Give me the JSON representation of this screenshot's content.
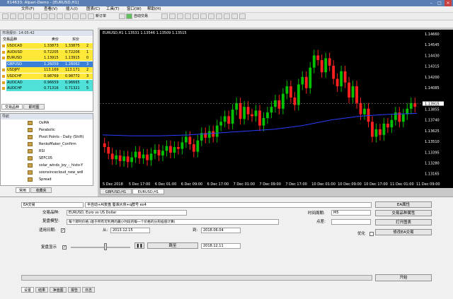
{
  "window": {
    "title": "814633: Alpari-Demo - [EURUSD,H1]"
  },
  "menu": [
    "文件(F)",
    "查看(V)",
    "插入(I)",
    "图表(C)",
    "工具(T)",
    "窗口(W)",
    "帮助(H)"
  ],
  "toolbar": {
    "new_order": "新订单",
    "autotrade": "自动交易"
  },
  "market_watch": {
    "header": "市场报价: 14:05:42",
    "columns": [
      "交易品种",
      "卖价",
      "买价",
      ""
    ],
    "rows": [
      {
        "symbol": "USDCAD",
        "bid": "1.33873",
        "ask": "1.33875",
        "spread": "2",
        "color": "#ffe838"
      },
      {
        "symbol": "AUDUSD",
        "bid": "0.72205",
        "ask": "0.72206",
        "spread": "1",
        "color": "#ffe838"
      },
      {
        "symbol": "EURUSD",
        "bid": "1.13915",
        "ask": "1.13915",
        "spread": "0",
        "color": "#ffe838"
      },
      {
        "symbol": "GBPUSD",
        "bid": "1.26059",
        "ask": "1.26062",
        "spread": "3",
        "color": "#3a7fd8"
      },
      {
        "symbol": "USDJPY",
        "bid": "113.169",
        "ask": "113.171",
        "spread": "2",
        "color": "#ffe838"
      },
      {
        "symbol": "USDCHF",
        "bid": "0.98769",
        "ask": "0.98772",
        "spread": "3",
        "color": "#ffe838"
      },
      {
        "symbol": "AUDCAD",
        "bid": "0.96659",
        "ask": "0.96665",
        "spread": "6",
        "color": "#4fe0d8"
      },
      {
        "symbol": "AUDCHF",
        "bid": "0.71316",
        "ask": "0.71321",
        "spread": "5",
        "color": "#4fe0d8"
      }
    ],
    "tabs": [
      "交易品种",
      "即时图"
    ]
  },
  "navigator": {
    "header": "导航",
    "items": [
      "OsMA",
      "Parabolic",
      "Pivot Points - Daily (Shift)",
      "RenkoMaker_Confirm",
      "RSI",
      "SEFC05",
      "solar_winds_joy_-_histo-Y",
      "soonsincecloud_new_wdl",
      "Spread"
    ],
    "tabs": [
      "常用",
      "收藏夹"
    ]
  },
  "chart": {
    "header": "EURUSD,H1  1.13531 1.13546 1.13509 1.13515",
    "current_price": "1.13915",
    "tabs": [
      "GBPUSD,H1",
      "EURUSD,H1"
    ],
    "active_tab": "EURUSD,H1"
  },
  "chart_data": {
    "type": "candlestick",
    "symbol": "EURUSD",
    "timeframe": "H1",
    "ylim": [
      1.1311,
      1.1466
    ],
    "y_ticks": [
      "1.14660",
      "1.14545",
      "1.14430",
      "1.14315",
      "1.14200",
      "1.14085",
      "1.13915",
      "1.13855",
      "1.13740",
      "1.13625",
      "1.13510",
      "1.13395",
      "1.13280",
      "1.13165"
    ],
    "x_ticks": [
      "5 Dec 2018",
      "5 Dec 17:00",
      "6 Dec 01:00",
      "6 Dec 09:00",
      "6 Dec 17:00",
      "7 Dec 01:00",
      "7 Dec 09:00",
      "7 Dec 17:00",
      "10 Dec 01:00",
      "10 Dec 09:00",
      "10 Dec 17:00",
      "11 Dec 01:00",
      "11 Dec 09:00"
    ],
    "closes": [
      1.1345,
      1.1338,
      1.1332,
      1.1336,
      1.133,
      1.1335,
      1.1329,
      1.1334,
      1.134,
      1.1333,
      1.1337,
      1.1331,
      1.1338,
      1.1342,
      1.1336,
      1.1341,
      1.1346,
      1.1339,
      1.1345,
      1.1343,
      1.135,
      1.1356,
      1.1348,
      1.134,
      1.1352,
      1.136,
      1.1355,
      1.1362,
      1.1356,
      1.1368,
      1.1372,
      1.1378,
      1.137,
      1.1385,
      1.1392,
      1.1375,
      1.1388,
      1.138,
      1.1378,
      1.1384,
      1.1368,
      1.1376,
      1.1382,
      1.1388,
      1.1395,
      1.1386,
      1.1402,
      1.141,
      1.1398,
      1.139,
      1.1412,
      1.142,
      1.1408,
      1.143,
      1.1443,
      1.1438,
      1.1425,
      1.144,
      1.1432,
      1.1418,
      1.141,
      1.1426,
      1.1414,
      1.1398,
      1.141,
      1.1392,
      1.138,
      1.1386,
      1.1372,
      1.1356,
      1.1364,
      1.1358,
      1.137,
      1.1366,
      1.1374,
      1.1382,
      1.1372,
      1.138,
      1.1386,
      1.1392,
      1.1388
    ],
    "ma_ylevels": [
      1.1358,
      1.1357,
      1.1357,
      1.1358,
      1.136,
      1.1362,
      1.1364,
      1.1368,
      1.1374,
      1.1378,
      1.138,
      1.1381
    ]
  },
  "tester": {
    "ea_select": "EA交易",
    "ea_name": "半自动+AI复盘  蜀湘大侠+q群号 ex4",
    "ea_props_btn": "EA属性",
    "symbol_label": "交易品种:",
    "symbol_value": "EURUSD, Euro vs US Dollar",
    "symbol_props_btn": "交易品种属性",
    "period_label": "时间周期:",
    "period_value": "M5",
    "model_label": "复盘模型:",
    "model_value": "每个即时价格 (基于所有可利用的最小时段的每一个价格的分形插值计算)",
    "spread_label": "点差:",
    "open_chart_btn": "打开图表",
    "use_date_label": "适用日期:",
    "from_label": "从:",
    "from_value": "2013.12.15",
    "to_label": "到:",
    "to_value": "2018.06.04",
    "optimize_label": "优化",
    "modify_ea_btn": "修改EA交易",
    "visual_label": "复盘显示",
    "skip_btn": "跳至",
    "skip_date": "2018.12.11",
    "start_btn": "开始",
    "bottom_tabs": [
      "设置",
      "结果",
      "净值图",
      "报告",
      "日志"
    ]
  }
}
